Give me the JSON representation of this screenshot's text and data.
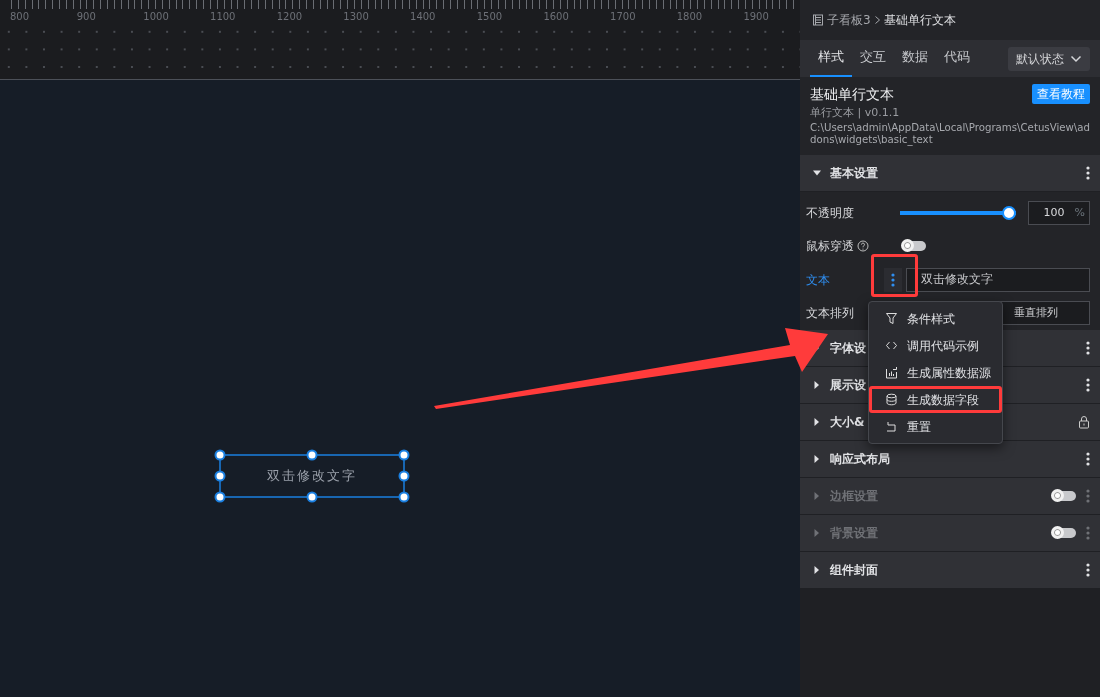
{
  "ruler": {
    "labels": [
      "800",
      "900",
      "1000",
      "1100",
      "1200",
      "1300",
      "1400",
      "1500",
      "1600",
      "1700",
      "1800",
      "1900"
    ]
  },
  "canvas": {
    "widget": {
      "text": "双击修改文字",
      "selected": true
    }
  },
  "panel": {
    "breadcrumb": {
      "parent": "子看板3",
      "current": "基础单行文本"
    },
    "tabs": [
      {
        "label": "样式",
        "selected": true
      },
      {
        "label": "交互",
        "selected": false
      },
      {
        "label": "数据",
        "selected": false
      },
      {
        "label": "代码",
        "selected": false
      }
    ],
    "state_dropdown": "默认状态",
    "component": {
      "title": "基础单行文本",
      "subtitle": "单行文本 | v0.1.1",
      "path": "C:\\Users\\admin\\AppData\\Local\\Programs\\CetusView\\addons\\widgets\\basic_text",
      "tutorial_button": "查看教程"
    },
    "basic_settings": {
      "title": "基本设置",
      "expanded": true,
      "opacity": {
        "label": "不透明度",
        "level": 1,
        "value": "100",
        "unit": "%"
      },
      "mouse_through": {
        "label": "鼠标穿透",
        "on": false
      },
      "text": {
        "label": "文本",
        "value": "双击修改文字",
        "highlighted": true
      },
      "arrangement": {
        "label": "文本排列",
        "option": "垂直排列",
        "selected": false
      }
    },
    "sections": [
      {
        "title": "字体设",
        "disabled": false,
        "kind": "menu"
      },
      {
        "title": "展示设",
        "disabled": false,
        "kind": "menu"
      },
      {
        "title": "大小&",
        "disabled": false,
        "kind": "lock"
      },
      {
        "title": "响应式布局",
        "disabled": false,
        "kind": "menu"
      },
      {
        "title": "边框设置",
        "disabled": true,
        "kind": "toggle",
        "on": false
      },
      {
        "title": "背景设置",
        "disabled": true,
        "kind": "toggle",
        "on": false
      },
      {
        "title": "组件封面",
        "disabled": false,
        "kind": "menu"
      }
    ]
  },
  "context_menu": {
    "items": [
      {
        "label": "条件样式",
        "kind": "filter",
        "highlighted": false
      },
      {
        "label": "调用代码示例",
        "kind": "code",
        "highlighted": false
      },
      {
        "label": "生成属性数据源",
        "kind": "chart",
        "highlighted": false
      },
      {
        "label": "生成数据字段",
        "kind": "database",
        "highlighted": true
      },
      {
        "label": "重置",
        "kind": "reset",
        "highlighted": false
      }
    ]
  },
  "annotation_arrow": true
}
